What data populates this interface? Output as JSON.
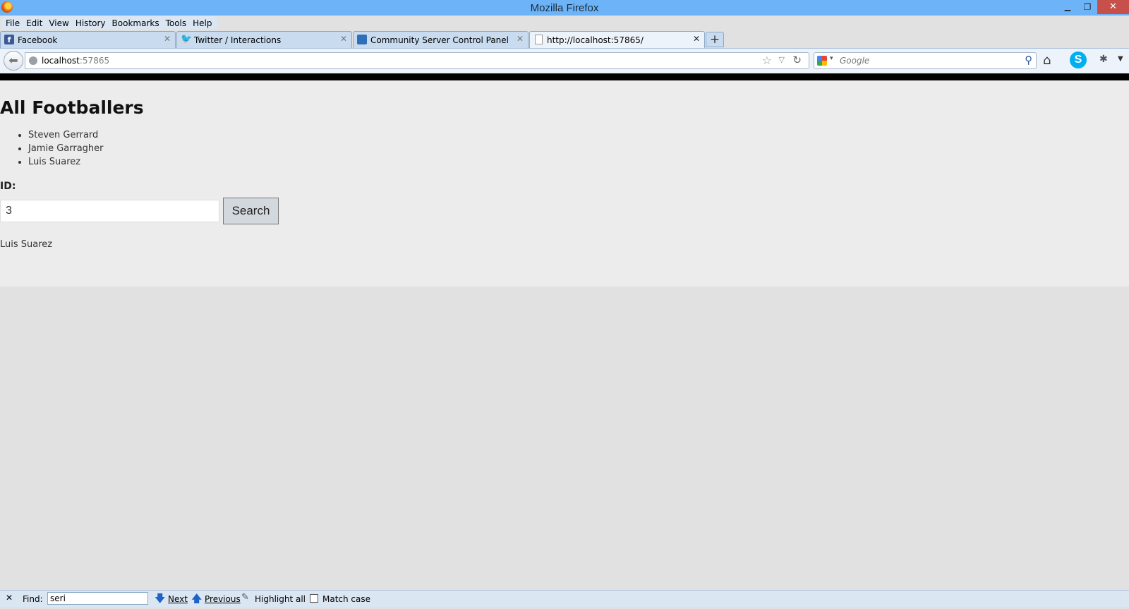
{
  "window": {
    "title": "Mozilla Firefox",
    "controls": {
      "minimize": "▁",
      "maximize": "❐",
      "close": "✕"
    }
  },
  "menu": [
    "File",
    "Edit",
    "View",
    "History",
    "Bookmarks",
    "Tools",
    "Help"
  ],
  "tabs": [
    {
      "label": "Facebook",
      "icon": "facebook-icon",
      "active": false
    },
    {
      "label": "Twitter / Interactions",
      "icon": "twitter-icon",
      "active": false
    },
    {
      "label": "Community Server Control Panel",
      "icon": "community-server-icon",
      "active": false
    },
    {
      "label": "http://localhost:57865/",
      "icon": "page-icon",
      "active": true
    }
  ],
  "new_tab_label": "+",
  "navbar": {
    "url_host": "localhost",
    "url_port": ":57865",
    "search_placeholder": "Google"
  },
  "page": {
    "heading": "All Footballers",
    "players": [
      "Steven Gerrard",
      "Jamie Garragher",
      "Luis Suarez"
    ],
    "id_label": "ID:",
    "id_value": "3",
    "search_button": "Search",
    "result": "Luis Suarez"
  },
  "findbar": {
    "close": "✕",
    "label": "Find:",
    "query": "seri",
    "next": "Next",
    "previous": "Previous",
    "highlight_all": "Highlight all",
    "match_case": "Match case"
  },
  "colors": {
    "titlebar": "#6db3f8",
    "close_button": "#c7504a",
    "page_background": "#ececec",
    "find_arrows": "#1f63c6"
  }
}
